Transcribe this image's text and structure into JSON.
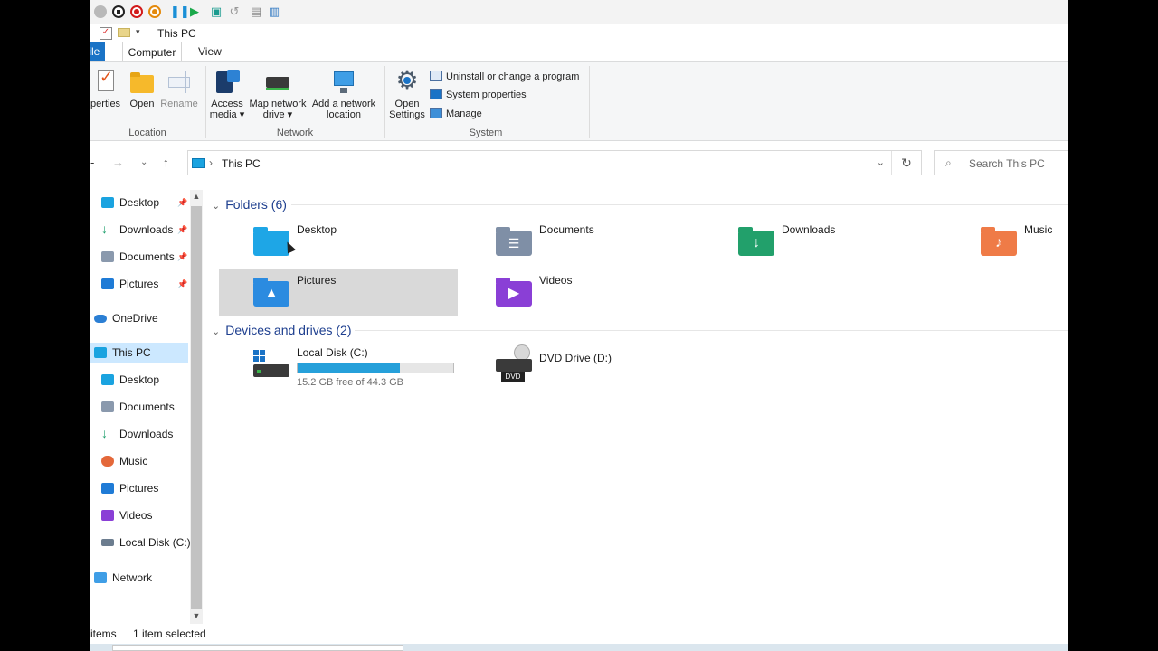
{
  "window": {
    "title": "This PC"
  },
  "ribbon": {
    "tabs": {
      "file": "File",
      "computer": "Computer",
      "view": "View"
    },
    "location": {
      "label": "Location",
      "properties": "Properties",
      "open": "Open",
      "rename": "Rename"
    },
    "network": {
      "label": "Network",
      "access_media_1": "Access",
      "access_media_2": "media ▾",
      "map_drive_1": "Map network",
      "map_drive_2": "drive ▾",
      "add_location_1": "Add a network",
      "add_location_2": "location"
    },
    "system": {
      "label": "System",
      "open_settings_1": "Open",
      "open_settings_2": "Settings",
      "uninstall": "Uninstall or change a program",
      "system_properties": "System properties",
      "manage": "Manage"
    }
  },
  "address": {
    "path": "This PC",
    "search_placeholder": "Search This PC"
  },
  "nav": {
    "quick_access": [
      {
        "label": "Desktop",
        "color": "#1aa3e0"
      },
      {
        "label": "Downloads",
        "color": "#1b9e6a"
      },
      {
        "label": "Documents",
        "color": "#8a99ad"
      },
      {
        "label": "Pictures",
        "color": "#1f7bd6"
      }
    ],
    "onedrive": "OneDrive",
    "this_pc": "This PC",
    "pc_children": [
      {
        "label": "Desktop",
        "color": "#1aa3e0"
      },
      {
        "label": "Documents",
        "color": "#8a99ad"
      },
      {
        "label": "Downloads",
        "color": "#1b9e6a"
      },
      {
        "label": "Music",
        "color": "#e4683a"
      },
      {
        "label": "Pictures",
        "color": "#1f7bd6"
      },
      {
        "label": "Videos",
        "color": "#8a3fd6"
      },
      {
        "label": "Local Disk (C:)",
        "color": "#6c7d8f"
      }
    ],
    "network": "Network"
  },
  "content": {
    "folders_header": "Folders (6)",
    "folders": [
      {
        "name": "Desktop",
        "color": "#1ea6e6"
      },
      {
        "name": "Documents",
        "color": "#7f8fa6"
      },
      {
        "name": "Downloads",
        "color": "#22a06b"
      },
      {
        "name": "Music",
        "color": "#ef7b47"
      },
      {
        "name": "Pictures",
        "color": "#2b8be0"
      },
      {
        "name": "Videos",
        "color": "#8a3fd6"
      }
    ],
    "drives_header": "Devices and drives (2)",
    "drives": [
      {
        "name": "Local Disk (C:)",
        "free_text": "15.2 GB free of 44.3 GB",
        "used_fraction": 0.657
      },
      {
        "name": "DVD Drive (D:)",
        "badge": "DVD"
      }
    ]
  },
  "status": {
    "items": "items",
    "selected": "1 item selected"
  },
  "colors": {
    "accent": "#1a73c6",
    "selection": "#cce8ff",
    "header": "#1e3f8f"
  }
}
